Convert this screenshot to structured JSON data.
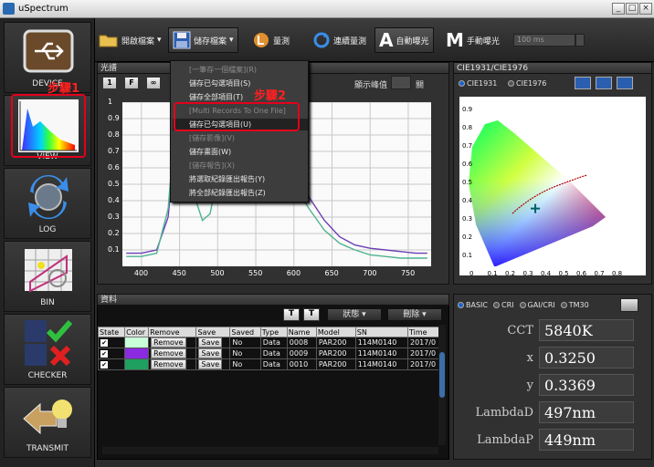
{
  "window": {
    "title": "uSpectrum",
    "controls": [
      "_",
      "□",
      "×"
    ]
  },
  "sidebar": {
    "items": [
      {
        "label": "DEVICE"
      },
      {
        "label": "VIEW"
      },
      {
        "label": "LOG"
      },
      {
        "label": "BIN"
      },
      {
        "label": "CHECKER"
      },
      {
        "label": "TRANSMIT"
      }
    ]
  },
  "toolbar": {
    "open_label": "開啟檔案",
    "save_label": "儲存檔案",
    "measure_label": "量測",
    "continuous_label": "連續量測",
    "auto_letter": "A",
    "auto_label": "自動曝光",
    "manual_letter": "M",
    "manual_label": "手動曝光",
    "exposure_value": "100 ms"
  },
  "menu": {
    "items": [
      {
        "label": "[一筆存一個檔案](R)",
        "enabled": false
      },
      {
        "label": "儲存已勾選項目(S)",
        "enabled": true
      },
      {
        "label": "儲存全部項目(T)",
        "enabled": true
      },
      {
        "label": "[Multi Records To One File]",
        "enabled": false
      },
      {
        "label": "儲存已勾選項目(U)",
        "enabled": true,
        "selected": true
      },
      {
        "label": "[儲存影像](V)",
        "enabled": false
      },
      {
        "label": "儲存畫面(W)",
        "enabled": true
      },
      {
        "label": "[儲存報告](X)",
        "enabled": false
      },
      {
        "label": "將選取紀錄匯出報告(Y)",
        "enabled": true
      },
      {
        "label": "將全部紀錄匯出報告(Z)",
        "enabled": true
      }
    ]
  },
  "callouts": {
    "step1": "步驟1",
    "step2": "步驟2"
  },
  "spectrum": {
    "title": "光譜",
    "buttons": [
      "1",
      "F",
      "∞"
    ],
    "peak_label": "顯示峰值",
    "peak_toggle": "關"
  },
  "chart_data": {
    "type": "line",
    "title": "",
    "xlabel": "",
    "ylabel": "",
    "xlim": [
      375,
      780
    ],
    "ylim": [
      0,
      1
    ],
    "xticks": [
      400,
      450,
      500,
      550,
      600,
      650,
      700,
      750
    ],
    "yticks": [
      0.1,
      0.2,
      0.3,
      0.4,
      0.5,
      0.6,
      0.7,
      0.8,
      0.9,
      1
    ],
    "grid": true,
    "series": [
      {
        "color": "#6b3fb5",
        "x": [
          380,
          400,
          420,
          435,
          445,
          450,
          460,
          470,
          480,
          490,
          500,
          510,
          520,
          530,
          540,
          550,
          560,
          570,
          580,
          590,
          600,
          620,
          640,
          660,
          680,
          700,
          720,
          740,
          760,
          775
        ],
        "y": [
          0.08,
          0.08,
          0.1,
          0.3,
          0.78,
          0.95,
          0.72,
          0.5,
          0.42,
          0.45,
          0.62,
          0.78,
          0.85,
          0.84,
          0.84,
          0.84,
          0.8,
          0.75,
          0.7,
          0.65,
          0.58,
          0.42,
          0.28,
          0.18,
          0.13,
          0.11,
          0.1,
          0.09,
          0.08,
          0.08
        ]
      },
      {
        "color": "#4fb48e",
        "x": [
          380,
          400,
          420,
          435,
          445,
          450,
          460,
          470,
          480,
          490,
          500,
          510,
          520,
          530,
          540,
          550,
          560,
          570,
          580,
          590,
          600,
          620,
          640,
          660,
          680,
          700,
          720,
          740,
          760,
          775
        ],
        "y": [
          0.06,
          0.06,
          0.08,
          0.35,
          0.92,
          1.0,
          0.7,
          0.42,
          0.28,
          0.32,
          0.55,
          0.72,
          0.8,
          0.78,
          0.76,
          0.75,
          0.72,
          0.68,
          0.63,
          0.57,
          0.5,
          0.35,
          0.22,
          0.14,
          0.1,
          0.07,
          0.06,
          0.05,
          0.05,
          0.05
        ]
      }
    ]
  },
  "cie": {
    "title": "CIE1931/CIE1976",
    "mode_a": "CIE1931",
    "mode_b": "CIE1976",
    "xticks": [
      "0",
      "0.1",
      "0.2",
      "0.3",
      "0.4",
      "0.5",
      "0.6",
      "0.7",
      "0.8"
    ],
    "yticks": [
      "0.9",
      "0.8",
      "0.7",
      "0.6",
      "0.5",
      "0.4",
      "0.3",
      "0.2",
      "0.1"
    ],
    "point": {
      "x": 0.325,
      "y": 0.3369
    }
  },
  "data_panel": {
    "title": "資料",
    "status_btn": "狀態",
    "delete_btn": "刪除",
    "columns": [
      "State",
      "Color",
      "Remove",
      "Save",
      "Saved",
      "Type",
      "Name",
      "Model",
      "SN",
      "Time"
    ],
    "rows": [
      {
        "color": "#c8ffd8",
        "remove": "Remove",
        "save": "Save",
        "saved": "No",
        "type": "Data",
        "name": "0008",
        "model": "PAR200",
        "sn": "114M0140",
        "time": "2017/0"
      },
      {
        "color": "#8a2be2",
        "remove": "Remove",
        "save": "Save",
        "saved": "No",
        "type": "Data",
        "name": "0009",
        "model": "PAR200",
        "sn": "114M0140",
        "time": "2017/0"
      },
      {
        "color": "#1fa060",
        "remove": "Remove",
        "save": "Save",
        "saved": "No",
        "type": "Data",
        "name": "0010",
        "model": "PAR200",
        "sn": "114M0140",
        "time": "2017/0"
      }
    ]
  },
  "metrics_tabs": [
    "BASIC",
    "CRI",
    "GAI/CRI",
    "TM30"
  ],
  "metrics": [
    {
      "label": "CCT",
      "value": "5840K"
    },
    {
      "label": "x",
      "value": "0.3250"
    },
    {
      "label": "y",
      "value": "0.3369"
    },
    {
      "label": "LambdaD",
      "value": "497nm"
    },
    {
      "label": "LambdaP",
      "value": "449nm"
    }
  ]
}
